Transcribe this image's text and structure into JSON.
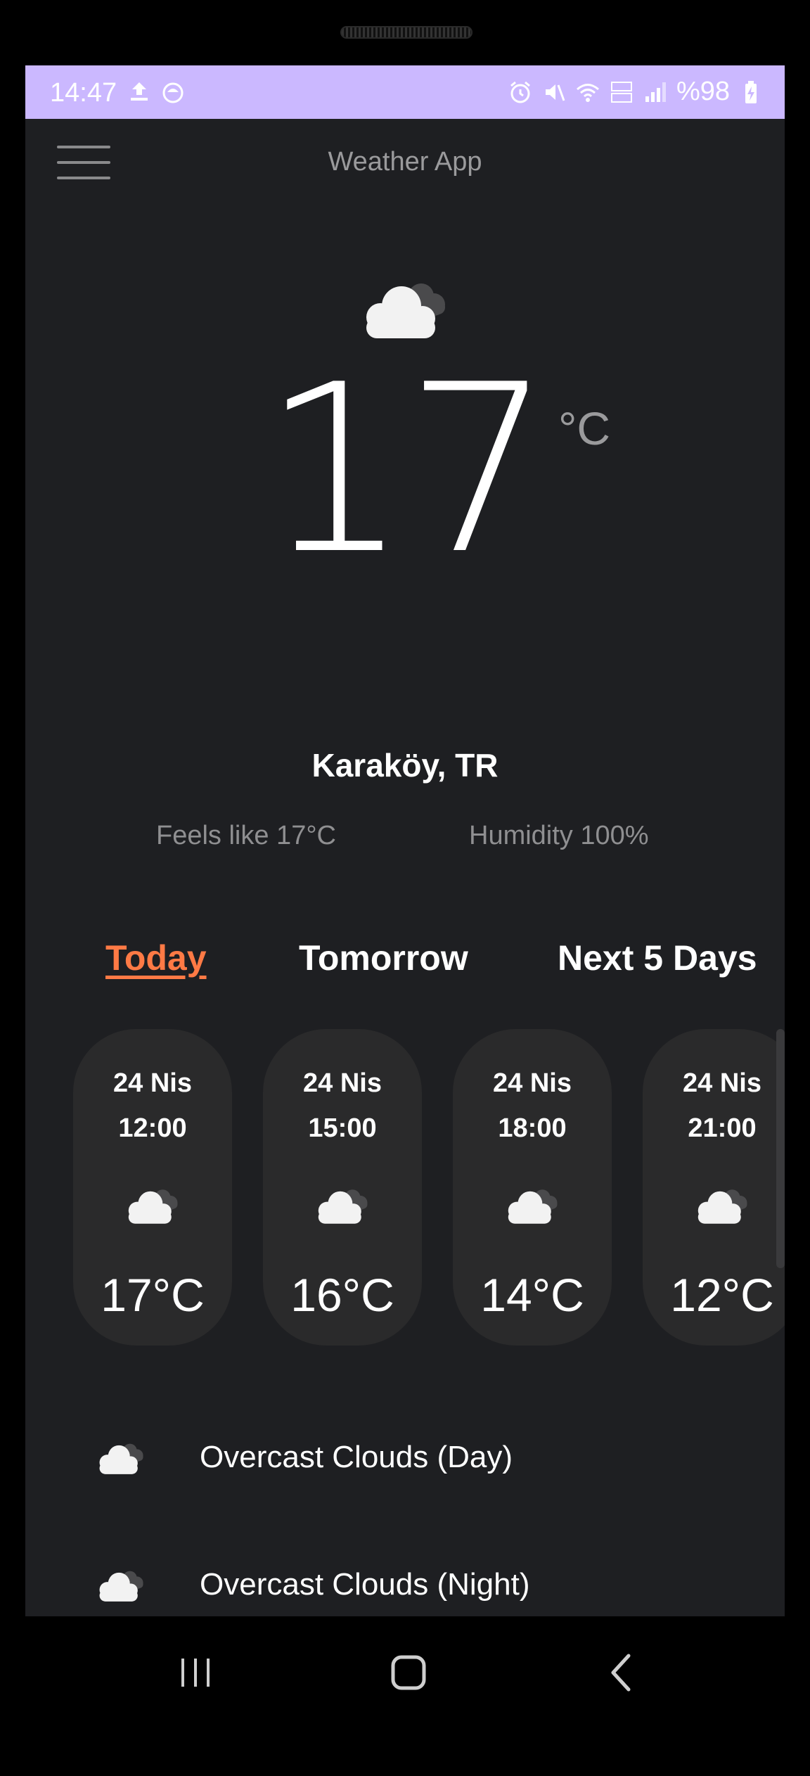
{
  "status_bar": {
    "time": "14:47",
    "battery": "%98"
  },
  "app_bar": {
    "title": "Weather App"
  },
  "current": {
    "temperature": "17",
    "unit": "°C",
    "location": "Karaköy, TR",
    "feels_like": "Feels like 17°C",
    "humidity": "Humidity 100%"
  },
  "tabs": [
    {
      "label": "Today",
      "active": true
    },
    {
      "label": "Tomorrow",
      "active": false
    },
    {
      "label": "Next 5 Days",
      "active": false
    }
  ],
  "hourly": [
    {
      "date": "24 Nis",
      "time": "12:00",
      "temp": "17°C"
    },
    {
      "date": "24 Nis",
      "time": "15:00",
      "temp": "16°C"
    },
    {
      "date": "24 Nis",
      "time": "18:00",
      "temp": "14°C"
    },
    {
      "date": "24 Nis",
      "time": "21:00",
      "temp": "12°C"
    }
  ],
  "conditions": [
    {
      "label": "Overcast Clouds (Day)"
    },
    {
      "label": "Overcast Clouds (Night)"
    }
  ],
  "colors": {
    "status_bar": "#cbb8ff",
    "background": "#1e1f22",
    "card": "#2a2a2b",
    "accent": "#ff7a45"
  }
}
